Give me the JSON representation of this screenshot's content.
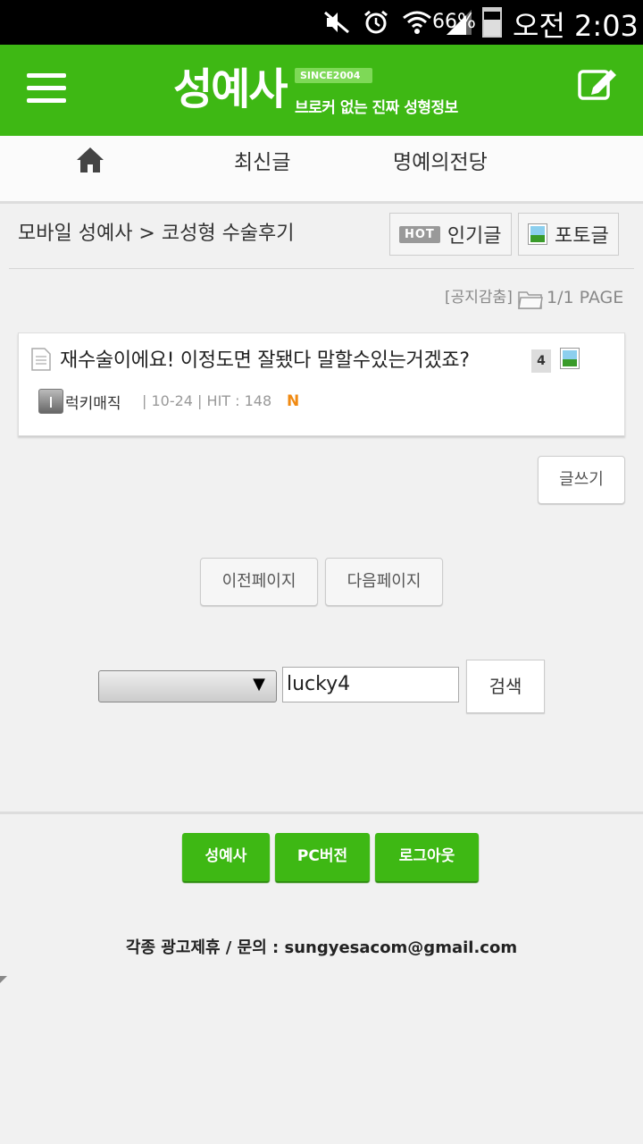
{
  "status_bar": {
    "battery_pct": "66%",
    "battery_level": 0.66,
    "time": "오전 2:03",
    "icons": [
      "mute-icon",
      "alarm-icon",
      "wifi-icon",
      "signal-icon",
      "battery-icon"
    ]
  },
  "header": {
    "logo": "성예사",
    "since": "SINCE2004",
    "tagline": "브로커 없는 진짜 성형정보",
    "brand_color": "#3eb814"
  },
  "nav": {
    "latest": "최신글",
    "hall_of_fame": "명예의전당"
  },
  "breadcrumb": "모바일 성예사 > 코성형 수술후기",
  "filters": {
    "hot_badge": "HOT",
    "popular": "인기글",
    "photo": "포토글"
  },
  "list_info": {
    "notice": "[공지감춤]",
    "page": "1/1 PAGE"
  },
  "posts": [
    {
      "title": "재수술이에요! 이정도면 잘됐다 말할수있는거겠죠?",
      "comments": "4",
      "author": "럭키매직",
      "meta": "| 10-24 |   HIT : 148",
      "new_badge": "N"
    }
  ],
  "actions": {
    "write": "글쓰기",
    "prev_page": "이전페이지",
    "next_page": "다음페이지"
  },
  "search": {
    "select_value": "",
    "query": "lucky4",
    "button": "검색"
  },
  "footer": {
    "home": "성예사",
    "pc": "PC버전",
    "logout": "로그아웃",
    "contact": "각종 광고제휴 / 문의 : sungyesacom@gmail.com"
  }
}
